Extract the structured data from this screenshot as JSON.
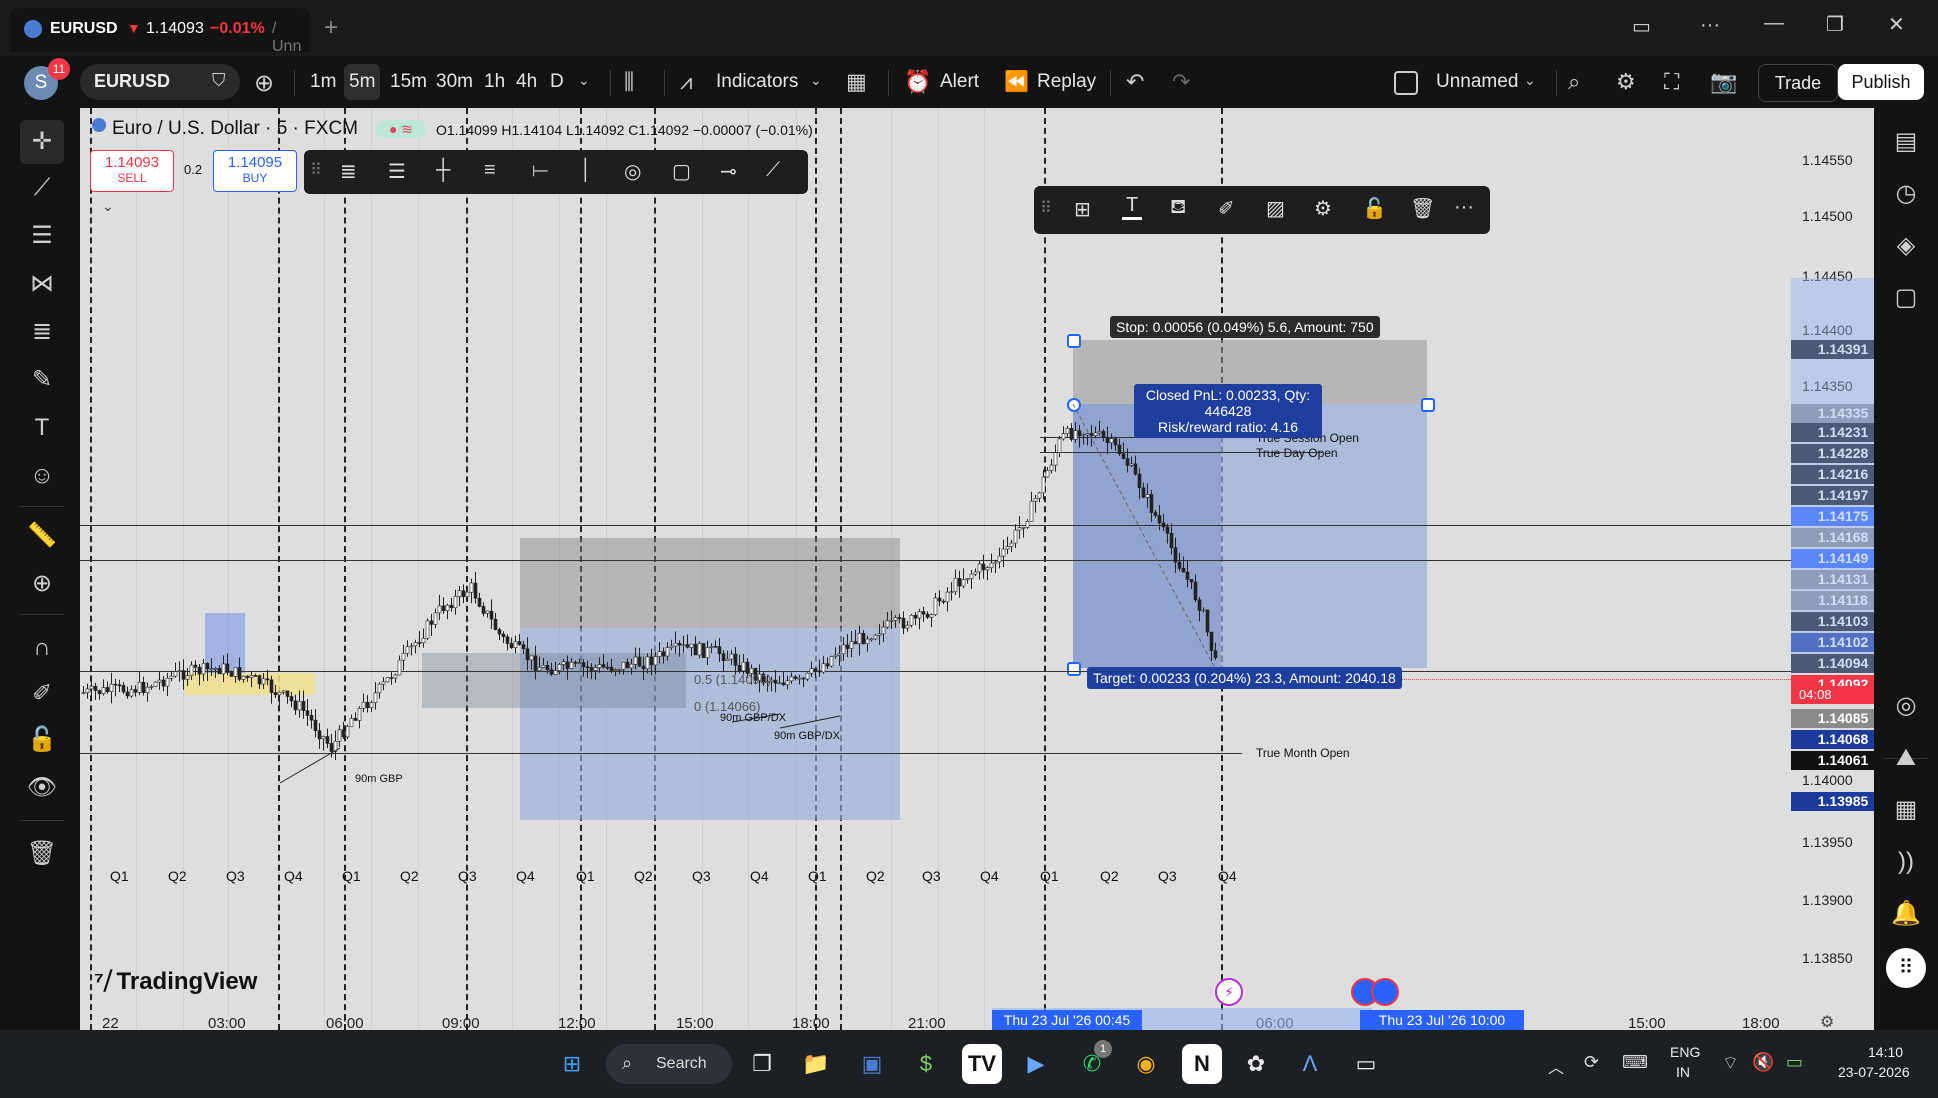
{
  "tab": {
    "symbol": "EURUSD",
    "price": "1.14093",
    "change": "−0.01%",
    "rest": "/ Unn",
    "badge": "11",
    "avatar": "S"
  },
  "toolbar": {
    "symbol": "EURUSD",
    "intervals": [
      "1m",
      "5m",
      "15m",
      "30m",
      "1h",
      "4h",
      "D"
    ],
    "indicators": "Indicators",
    "alert": "Alert",
    "replay": "Replay",
    "layout": "Unnamed",
    "trade": "Trade",
    "publish": "Publish"
  },
  "legend": {
    "title": "Euro / U.S. Dollar · 5 · FXCM",
    "ohlc": "O1.14099 H1.14104 L1.14092 C1.14092 −0.00007 (−0.01%)"
  },
  "trade": {
    "sell_price": "1.14093",
    "sell_label": "SELL",
    "spread": "0.2",
    "buy_price": "1.14095",
    "buy_label": "BUY"
  },
  "position": {
    "stop": "Stop: 0.00056 (0.049%) 5.6, Amount: 750",
    "pnl_line1": "Closed PnL: 0.00233, Qty: 446428",
    "pnl_line2": "Risk/reward ratio: 4.16",
    "target": "Target: 0.00233 (0.204%) 23.3, Amount: 2040.18"
  },
  "annotations": {
    "session_open": "True Session Open",
    "day_open": "True Day Open",
    "month_open": "True Month Open",
    "gbp1": "90m GBP",
    "gbp2": "90m GBP/DX",
    "gbp3": "90m GBP/DX",
    "fib05": "0.5 (1.14090)",
    "fib0": "0 (1.14066)"
  },
  "price_scale": [
    "1.14550",
    "1.14500",
    "1.14450",
    "1.14400",
    "1.14350",
    "1.14000",
    "1.13950",
    "1.13900",
    "1.13850"
  ],
  "price_labels": [
    {
      "v": "1.14391",
      "c": "#111111"
    },
    {
      "v": "1.14335",
      "c": "#8a8a8a"
    },
    {
      "v": "1.14231",
      "c": "#111111"
    },
    {
      "v": "1.14228",
      "c": "#111111"
    },
    {
      "v": "1.14216",
      "c": "#111111"
    },
    {
      "v": "1.14197",
      "c": "#111111"
    },
    {
      "v": "1.14175",
      "c": "#2962ff"
    },
    {
      "v": "1.14168",
      "c": "#8a8a8a"
    },
    {
      "v": "1.14149",
      "c": "#2962ff"
    },
    {
      "v": "1.14131",
      "c": "#8a8a8a"
    },
    {
      "v": "1.14118",
      "c": "#8a8a8a"
    },
    {
      "v": "1.14103",
      "c": "#111111"
    },
    {
      "v": "1.14102",
      "c": "#1a3a9c"
    },
    {
      "v": "1.14094",
      "c": "#111111"
    },
    {
      "v": "1.14092",
      "c": "#f23645"
    },
    {
      "v": "1.14085",
      "c": "#8a8a8a"
    },
    {
      "v": "1.14068",
      "c": "#1a3a9c"
    },
    {
      "v": "1.14061",
      "c": "#111111"
    },
    {
      "v": "1.13985",
      "c": "#1a3a9c"
    }
  ],
  "countdown": "04:08",
  "quarters": [
    "Q1",
    "Q2",
    "Q3",
    "Q4",
    "Q1",
    "Q2",
    "Q3",
    "Q4",
    "Q1",
    "Q2",
    "Q3",
    "Q4",
    "Q1",
    "Q2",
    "Q3",
    "Q4",
    "Q1",
    "Q2",
    "Q3",
    "Q4"
  ],
  "time_axis": [
    "22",
    "03:00",
    "06:00",
    "09:00",
    "12:00",
    "15:00",
    "18:00",
    "21:00",
    "06:00",
    "15:00",
    "18:00"
  ],
  "time_highlight": [
    "Thu 23 Jul '26",
    "00:45",
    "Thu 23 Jul '26",
    "10:00"
  ],
  "logo": "TradingView",
  "taskbar": {
    "search": "Search",
    "lang1": "ENG",
    "lang2": "IN",
    "time": "14:10",
    "date": "23-07-2026",
    "wa_badge": "1"
  },
  "colors": {
    "accent": "#2962ff",
    "sell": "#f23645",
    "chart_bg": "#dedede",
    "position_blue": "#9aaed6"
  }
}
